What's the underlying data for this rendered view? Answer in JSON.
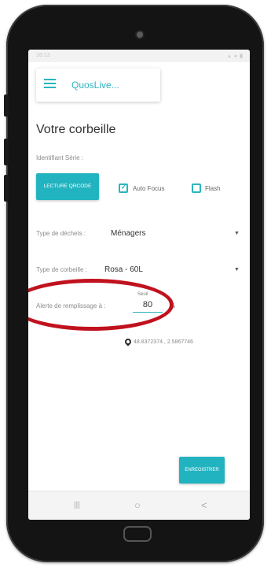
{
  "status_bar": {
    "time": "16:13",
    "icons": "▴ ◂ ▮"
  },
  "app_bar": {
    "menu_icon": "hamburger-icon",
    "title": "QuosLive..."
  },
  "page": {
    "title": "Votre corbeille"
  },
  "identifier": {
    "label": "Identifiant Série :",
    "scan_button": "LECTURE QRCODE",
    "autofocus": {
      "label": "Auto Focus",
      "checked": true
    },
    "flash": {
      "label": "Flash",
      "checked": false
    }
  },
  "waste_type": {
    "label": "Type de déchets :",
    "value": "Ménagers"
  },
  "bin_type": {
    "label": "Type de corbeille :",
    "value": "Rosa - 60L"
  },
  "fill_alert": {
    "label": "Alerte de remplissage à :",
    "hint": "Seuil",
    "value": "80",
    "unit": "%"
  },
  "location": {
    "icon": "location-pin-icon",
    "coords": "48.8372374 , 2.5867746"
  },
  "save_button": "ENREGISTRER",
  "nav_bar": {
    "recents": "|||",
    "home": "○",
    "back": "<"
  },
  "colors": {
    "accent": "#2ab4c0",
    "highlight": "#c0121e"
  }
}
